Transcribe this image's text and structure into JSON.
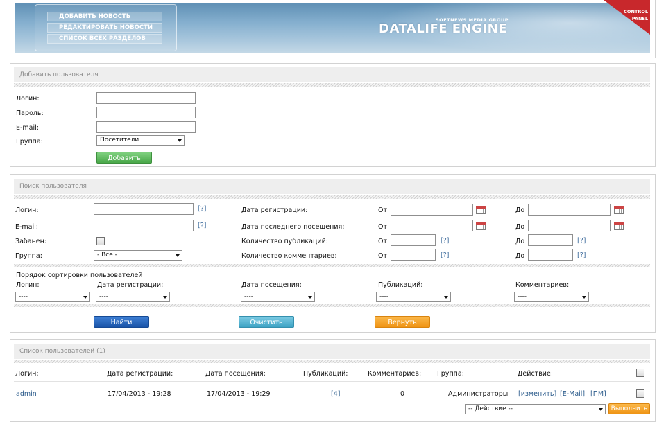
{
  "header": {
    "menu": [
      "ДОБАВИТЬ НОВОСТЬ",
      "РЕДАКТИРОВАТЬ НОВОСТИ",
      "СПИСОК ВСЕХ РАЗДЕЛОВ"
    ],
    "brand_sub": "SOFTNEWS MEDIA GROUP",
    "brand": "DATALIFE ENGINE",
    "corner_line1": "CONTROL",
    "corner_line2": "PANEL"
  },
  "add_user": {
    "title": "Добавить пользователя",
    "login_label": "Логин:",
    "password_label": "Пароль:",
    "email_label": "E-mail:",
    "group_label": "Группа:",
    "group_value": "Посетители",
    "submit_label": "Добавить"
  },
  "search": {
    "title": "Поиск пользователя",
    "login_label": "Логин:",
    "email_label": "E-mail:",
    "banned_label": "Забанен:",
    "group_label": "Группа:",
    "group_value": "- Все -",
    "hint": "[?]",
    "reg_date_label": "Дата регистрации:",
    "last_visit_label": "Дата последнего посещения:",
    "pubs_label": "Количество публикаций:",
    "comments_label": "Количество комментариев:",
    "from_label": "От",
    "to_label": "До",
    "sort_title": "Порядок сортировки пользователей",
    "sort_columns": [
      "Логин:",
      "Дата регистрации:",
      "Дата посещения:",
      "Публикаций:",
      "Комментариев:"
    ],
    "sort_value": "----",
    "find_label": "Найти",
    "clear_label": "Очистить",
    "reset_label": "Вернуть"
  },
  "users": {
    "title": "Список пользователей (1)",
    "columns": [
      "Логин:",
      "Дата регистрации:",
      "Дата посещения:",
      "Публикаций:",
      "Комментариев:",
      "Группа:",
      "Действие:"
    ],
    "rows": [
      {
        "login": "admin",
        "reg_date": "17/04/2013 - 19:28",
        "visit_date": "17/04/2013 - 19:29",
        "pubs": "[4]",
        "comments": "0",
        "group": "Администраторы",
        "edit": "[изменить]",
        "mail": "[E-Mail]",
        "pm": "[ПМ]"
      }
    ],
    "action_value": "-- Действие --",
    "execute_label": "Выполнить"
  },
  "colors": {
    "green_button": "#5cb85c",
    "blue_button": "#1e5fb8",
    "teal_button": "#4aaecf",
    "orange_button": "#f4a020",
    "link": "#2c5c8c"
  }
}
